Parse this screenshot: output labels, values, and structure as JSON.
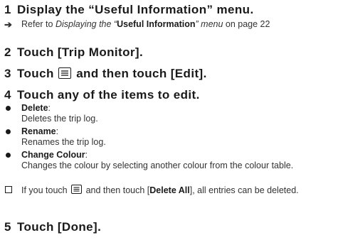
{
  "steps": [
    {
      "num": "1",
      "title": "Display the “Useful Information” menu."
    },
    {
      "num": "2",
      "title": "Touch [Trip Monitor]."
    },
    {
      "num": "3",
      "title_a": "Touch",
      "title_b": "and then touch [Edit]."
    },
    {
      "num": "4",
      "title": "Touch any of the items to edit."
    },
    {
      "num": "5",
      "title": "Touch [Done]."
    }
  ],
  "reference": {
    "arrow": "➔",
    "prefix": "Refer to ",
    "italic_a": "Displaying the “",
    "bold": "Useful Information",
    "italic_b": "” menu",
    "suffix": " on page 22"
  },
  "items": [
    {
      "label": "Delete",
      "colon": ":",
      "desc": "Deletes the trip log."
    },
    {
      "label": "Rename",
      "colon": ":",
      "desc": "Renames the trip log."
    },
    {
      "label": "Change Colour",
      "colon": ":",
      "desc": "Changes the colour by selecting another colour from the colour table."
    }
  ],
  "note": {
    "a": "If you touch",
    "b": "and then touch [",
    "bold": "Delete All",
    "c": "], all entries can be deleted."
  },
  "icons": {
    "menu": "menu-list-icon",
    "bullet": "bullet-dot-icon",
    "note": "note-checkbox-icon",
    "reference": "reference-arrow-icon"
  }
}
